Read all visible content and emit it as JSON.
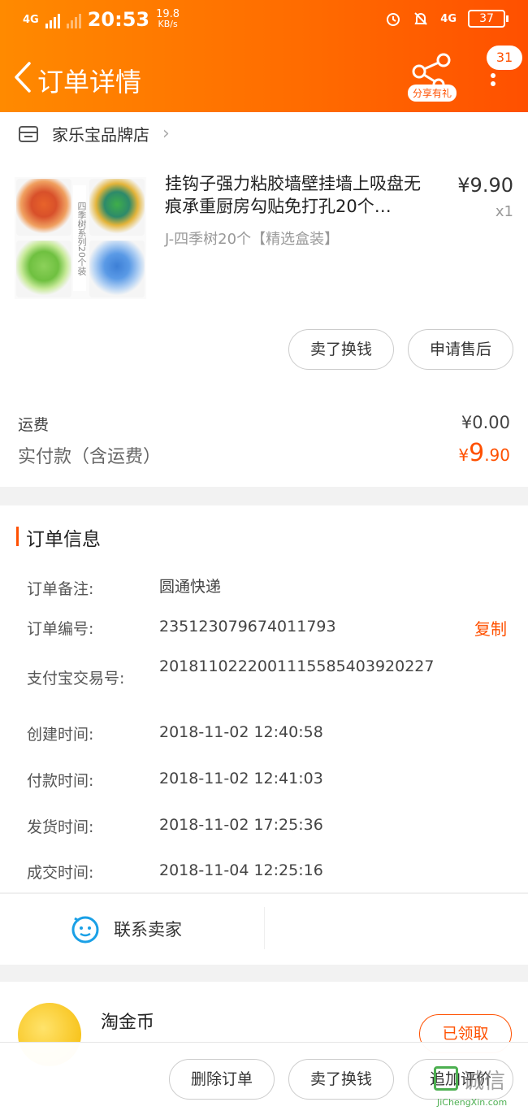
{
  "status_bar": {
    "network": "4G",
    "time": "20:53",
    "speed_value": "19.8",
    "speed_unit": "KB/s",
    "network_right": "4G",
    "battery": "37"
  },
  "nav": {
    "title": "订单详情",
    "share_badge": "分享有礼",
    "message_count": "31"
  },
  "store": {
    "name": "家乐宝品牌店"
  },
  "product": {
    "title": "挂钩子强力粘胶墙壁挂墙上吸盘无痕承重厨房勾贴免打孔20个…",
    "sku": "J-四季树20个【精选盒装】",
    "price": "¥9.90",
    "quantity": "x1",
    "image_label": "四季树系列20个装",
    "buttons": {
      "sell": "卖了换钱",
      "after_sale": "申请售后"
    }
  },
  "fees": {
    "shipping_label": "运费",
    "shipping_value": "¥0.00",
    "paid_label": "实付款（含运费）",
    "paid_currency": "¥",
    "paid_int": "9",
    "paid_dec": ".90"
  },
  "order_info": {
    "section_title": "订单信息",
    "copy_label": "复制",
    "rows": [
      {
        "label": "订单备注:",
        "value": "圆通快递"
      },
      {
        "label": "订单编号:",
        "value": "235123079674011793"
      },
      {
        "label": "支付宝交易号:",
        "value": "2018110222001115585403920227"
      },
      {
        "label": "创建时间:",
        "value": "2018-11-02 12:40:58"
      },
      {
        "label": "付款时间:",
        "value": "2018-11-02 12:41:03"
      },
      {
        "label": "发货时间:",
        "value": "2018-11-02 17:25:36"
      },
      {
        "label": "成交时间:",
        "value": "2018-11-04 12:25:16"
      }
    ]
  },
  "contact": {
    "label": "联系卖家"
  },
  "coin": {
    "title": "淘金币",
    "claim": "已领取"
  },
  "bottom_actions": {
    "delete": "删除订单",
    "sell": "卖了换钱",
    "review": "追加评价"
  },
  "watermark": {
    "text": "诚信",
    "sub": "JiChengXin.com"
  },
  "colors": {
    "accent": "#ff5000",
    "header_start": "#ff8a00"
  }
}
